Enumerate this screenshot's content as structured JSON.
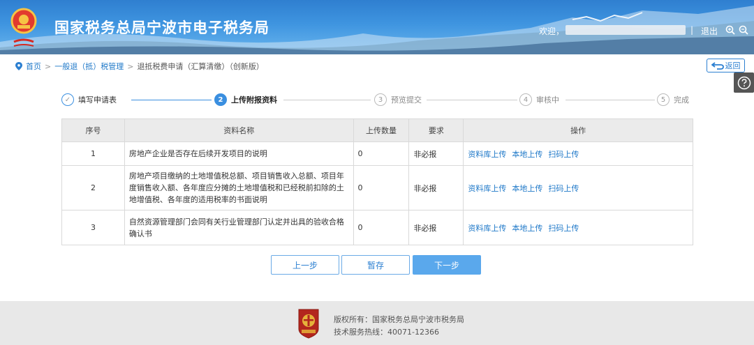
{
  "header": {
    "title": "国家税务总局宁波市电子税务局",
    "welcome": "欢迎，",
    "separator": "|",
    "logout": "退出"
  },
  "breadcrumb": {
    "items": [
      "首页",
      "一般退（抵）税管理",
      "退抵税费申请（汇算清缴）（创新版）"
    ],
    "separator": ">"
  },
  "back_button": "返回",
  "steps": [
    {
      "num": "✓",
      "label": "填写申请表",
      "state": "done"
    },
    {
      "num": "2",
      "label": "上传附报资料",
      "state": "active"
    },
    {
      "num": "3",
      "label": "预览提交",
      "state": "pending"
    },
    {
      "num": "4",
      "label": "审核中",
      "state": "pending"
    },
    {
      "num": "5",
      "label": "完成",
      "state": "pending"
    }
  ],
  "table": {
    "headers": [
      "序号",
      "资料名称",
      "上传数量",
      "要求",
      "操作"
    ],
    "rows": [
      {
        "no": "1",
        "name": "房地产企业是否存在后续开发项目的说明",
        "count": "0",
        "req": "非必报",
        "ops": [
          "资料库上传",
          "本地上传",
          "扫码上传"
        ]
      },
      {
        "no": "2",
        "name": "房地产项目缴纳的土地增值税总额、项目销售收入总额、项目年度销售收入额、各年度应分摊的土地增值税和已经税前扣除的土地增值税、各年度的适用税率的书面说明",
        "count": "0",
        "req": "非必报",
        "ops": [
          "资料库上传",
          "本地上传",
          "扫码上传"
        ]
      },
      {
        "no": "3",
        "name": "自然资源管理部门会同有关行业管理部门认定并出具的验收合格确认书",
        "count": "0",
        "req": "非必报",
        "ops": [
          "资料库上传",
          "本地上传",
          "扫码上传"
        ]
      }
    ]
  },
  "buttons": {
    "prev": "上一步",
    "save": "暂存",
    "next": "下一步"
  },
  "footer": {
    "copyright": "版权所有：国家税务总局宁波市税务局",
    "hotline": "技术服务热线：40071-12366"
  },
  "colors": {
    "accent": "#3a8fe0",
    "link": "#1e78c8",
    "header_top": "#2f7fd0",
    "footer_bg": "#e8e8e8"
  },
  "icons": {
    "back": "return-arrow-icon",
    "help": "question-circle-icon",
    "home": "location-pin-icon",
    "zoom_in": "zoom-in-icon",
    "zoom_out": "zoom-out-icon"
  }
}
